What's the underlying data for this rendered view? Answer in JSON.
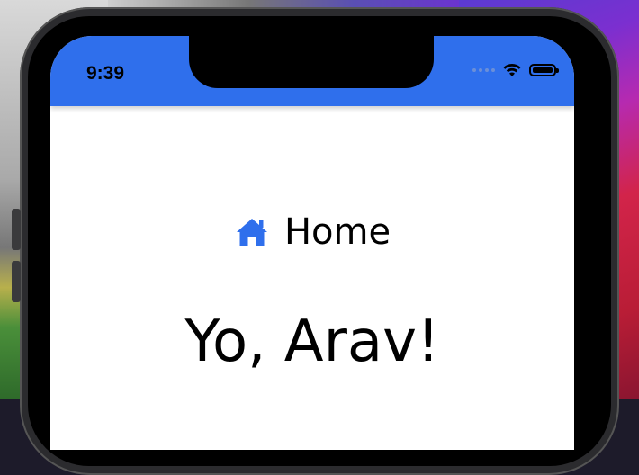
{
  "status_bar": {
    "time": "9:39",
    "icons": [
      "signal-dots-icon",
      "wifi-icon",
      "battery-icon"
    ]
  },
  "header": {
    "color": "#2f6fec"
  },
  "nav": {
    "icon": "home-icon",
    "label": "Home",
    "icon_color": "#2f6fec"
  },
  "main": {
    "greeting": "Yo, Arav!"
  }
}
